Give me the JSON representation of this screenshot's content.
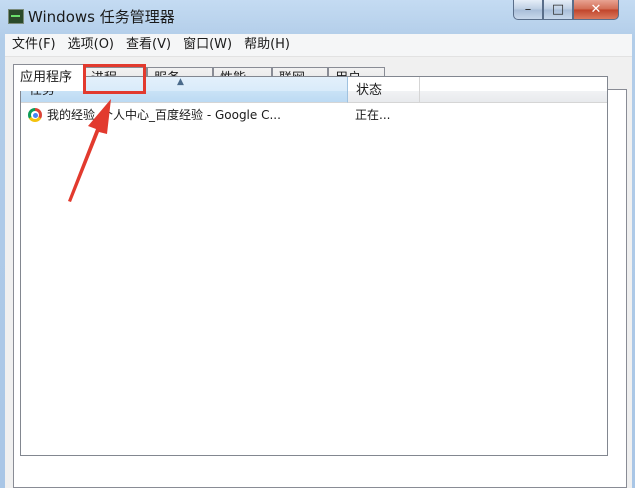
{
  "window": {
    "title": "Windows 任务管理器",
    "controls": {
      "minimize": "–",
      "maximize": "□",
      "close": "✕"
    }
  },
  "menu": [
    {
      "label": "文件(F)"
    },
    {
      "label": "选项(O)"
    },
    {
      "label": "查看(V)"
    },
    {
      "label": "窗口(W)"
    },
    {
      "label": "帮助(H)"
    }
  ],
  "tabs": [
    {
      "label": "应用程序",
      "active": true
    },
    {
      "label": "进程",
      "active": false
    },
    {
      "label": "服务",
      "active": false
    },
    {
      "label": "性能",
      "active": false
    },
    {
      "label": "联网",
      "active": false
    },
    {
      "label": "用户",
      "active": false
    }
  ],
  "list": {
    "columns": [
      {
        "label": "任务",
        "sorted": true
      },
      {
        "label": "状态",
        "sorted": false
      }
    ],
    "sort_indicator": "▲",
    "rows": [
      {
        "task": "我的经验_个人中心_百度经验 - Google C...",
        "status": "正在...",
        "icon": "chrome-icon"
      }
    ]
  },
  "annotation": {
    "color": "#e23a2e",
    "target": "进程"
  },
  "colors": {
    "accent": "#e23a2e",
    "panel_bg": "#ffffff",
    "frame": "#a9c6e6"
  }
}
